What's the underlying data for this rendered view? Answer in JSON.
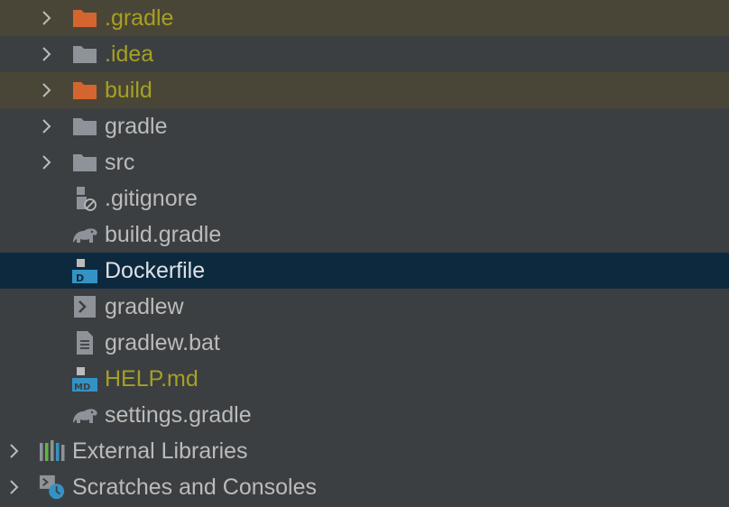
{
  "colors": {
    "background": "#3c3f41",
    "excluded_row": "#4a4637",
    "selected_row": "#0d293e",
    "text": "#bbbbbb",
    "text_unversioned": "#a6a022",
    "folder": "#8d9399",
    "folder_excluded": "#d4652f",
    "docker_blue": "#3592c4"
  },
  "tree": {
    "items": [
      {
        "label": ".gradle",
        "icon": "folder-excluded-icon",
        "expandable": true
      },
      {
        "label": ".idea",
        "icon": "folder-icon",
        "expandable": true
      },
      {
        "label": "build",
        "icon": "folder-excluded-icon",
        "expandable": true
      },
      {
        "label": "gradle",
        "icon": "folder-icon",
        "expandable": true
      },
      {
        "label": "src",
        "icon": "folder-icon",
        "expandable": true
      },
      {
        "label": ".gitignore",
        "icon": "ignore-file-icon",
        "expandable": false
      },
      {
        "label": "build.gradle",
        "icon": "gradle-elephant-icon",
        "expandable": false
      },
      {
        "label": "Dockerfile",
        "icon": "dockerfile-icon",
        "expandable": false,
        "selected": true
      },
      {
        "label": "gradlew",
        "icon": "shell-script-icon",
        "expandable": false
      },
      {
        "label": "gradlew.bat",
        "icon": "text-file-icon",
        "expandable": false
      },
      {
        "label": "HELP.md",
        "icon": "markdown-file-icon",
        "expandable": false
      },
      {
        "label": "settings.gradle",
        "icon": "gradle-elephant-icon",
        "expandable": false
      }
    ],
    "roots": [
      {
        "label": "External Libraries",
        "icon": "libraries-icon",
        "expandable": true
      },
      {
        "label": "Scratches and Consoles",
        "icon": "scratches-icon",
        "expandable": true
      }
    ]
  }
}
